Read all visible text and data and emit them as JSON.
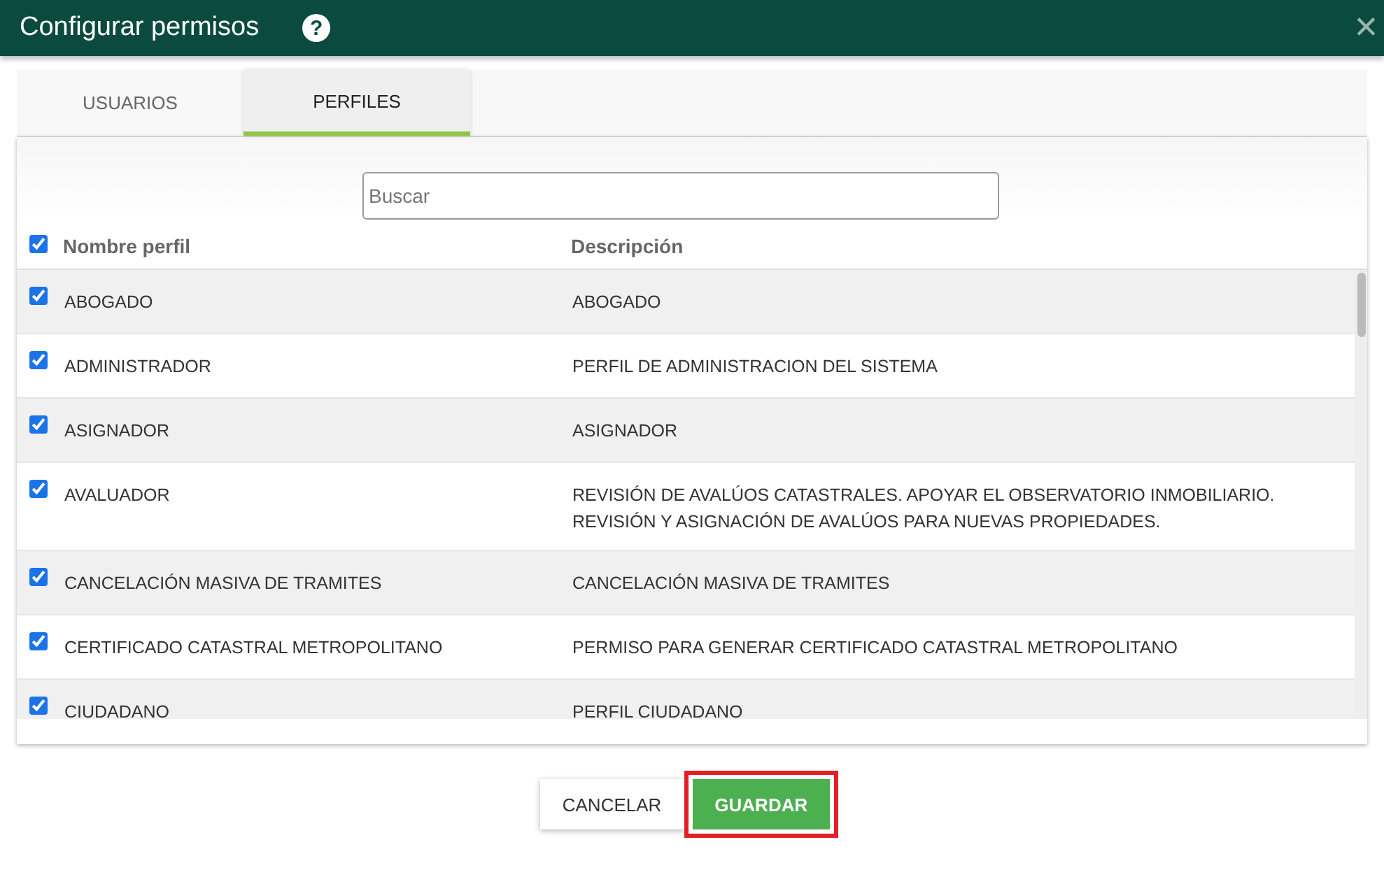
{
  "window": {
    "title": "Configurar permisos",
    "help_icon": "?",
    "close_icon": "✕"
  },
  "tabs": [
    {
      "label": "USUARIOS",
      "selected": false
    },
    {
      "label": "PERFILES",
      "selected": true
    }
  ],
  "search": {
    "placeholder": "Buscar"
  },
  "table": {
    "select_all_checked": true,
    "columns": [
      "Nombre perfil",
      "Descripción"
    ],
    "rows": [
      {
        "checked": true,
        "name": "ABOGADO",
        "description": "ABOGADO"
      },
      {
        "checked": true,
        "name": "ADMINISTRADOR",
        "description": "PERFIL DE ADMINISTRACION DEL SISTEMA"
      },
      {
        "checked": true,
        "name": "ASIGNADOR",
        "description": "ASIGNADOR"
      },
      {
        "checked": true,
        "name": "AVALUADOR",
        "description": "REVISIÓN DE AVALÚOS CATASTRALES. APOYAR EL OBSERVATORIO INMOBILIARIO. REVISIÓN Y ASIGNACIÓN DE AVALÚOS PARA NUEVAS PROPIEDADES."
      },
      {
        "checked": true,
        "name": "CANCELACIÓN MASIVA DE TRAMITES",
        "description": "CANCELACIÓN MASIVA DE TRAMITES"
      },
      {
        "checked": true,
        "name": "CERTIFICADO CATASTRAL METROPOLITANO",
        "description": "PERMISO PARA GENERAR CERTIFICADO CATASTRAL METROPOLITANO"
      },
      {
        "checked": true,
        "name": "CIUDADANO",
        "description": "PERFIL CIUDADANO"
      }
    ]
  },
  "buttons": [
    {
      "label": "CANCELAR",
      "kind": "secondary",
      "highlighted": false
    },
    {
      "label": "GUARDAR",
      "kind": "primary",
      "highlighted": true
    }
  ]
}
